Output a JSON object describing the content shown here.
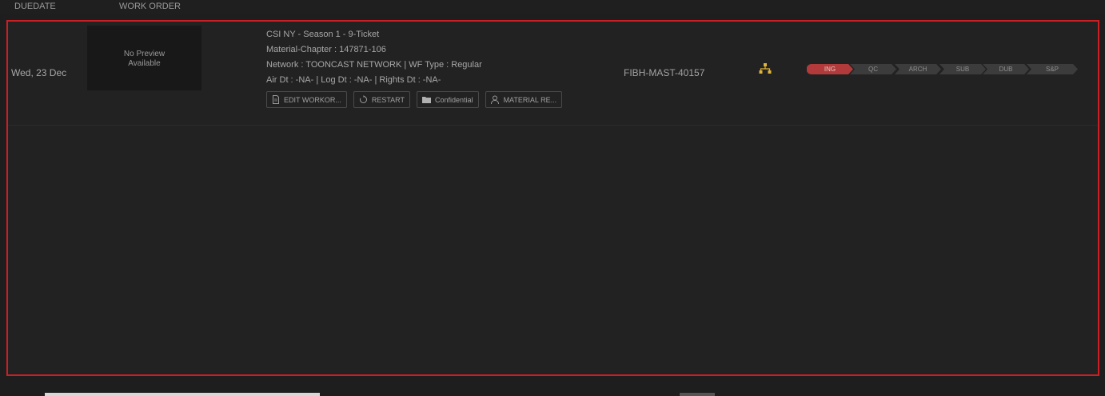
{
  "columns": {
    "duedate": "DUEDATE",
    "work_order": "WORK ORDER"
  },
  "row": {
    "duedate": "Wed, 23 Dec",
    "thumbnail_text": "No Preview Available",
    "title": "CSI NY - Season 1 - 9-Ticket",
    "material_chapter": "Material-Chapter : 147871-106",
    "network_line": "Network : TOONCAST NETWORK  | WF Type : Regular",
    "dates_line": "Air Dt : -NA-  | Log Dt : -NA-  | Rights Dt : -NA-",
    "actions": [
      {
        "label": "EDIT WORKOR...",
        "icon": "document-icon"
      },
      {
        "label": "RESTART",
        "icon": "restart-icon"
      },
      {
        "label": "Confidential",
        "icon": "folder-icon"
      },
      {
        "label": "MATERIAL RE...",
        "icon": "user-icon"
      }
    ],
    "master_id": "FIBH-MAST-40157",
    "hierarchy_icon": "hierarchy-icon",
    "pipeline": [
      {
        "label": "ING",
        "status": "active"
      },
      {
        "label": "QC",
        "status": "pending"
      },
      {
        "label": "ARCH",
        "status": "pending"
      },
      {
        "label": "SUB",
        "status": "pending"
      },
      {
        "label": "DUB",
        "status": "pending"
      },
      {
        "label": "S&P",
        "status": "pending"
      }
    ]
  },
  "colors": {
    "background": "#1e1e1e",
    "panel": "#222222",
    "selection_border": "#cc1f24",
    "stage_active": "#b23a3a",
    "stage_pending": "#3c3c3c",
    "hierarchy_icon": "#e0b43a"
  }
}
